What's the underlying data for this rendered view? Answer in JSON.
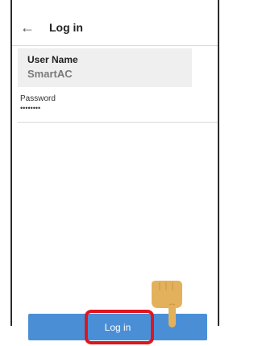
{
  "header": {
    "back_icon": "←",
    "title": "Log in"
  },
  "form": {
    "username_label": "User Name",
    "username_value": "SmartAC",
    "password_label": "Password",
    "password_value": "••••••••"
  },
  "login_button_label": "Log in",
  "colors": {
    "button": "#4a8fd6",
    "highlight": "#e0151f",
    "hand": "#e3b15c"
  },
  "icons": {
    "back": "arrow-left-icon",
    "pointer": "pointing-hand-icon"
  }
}
